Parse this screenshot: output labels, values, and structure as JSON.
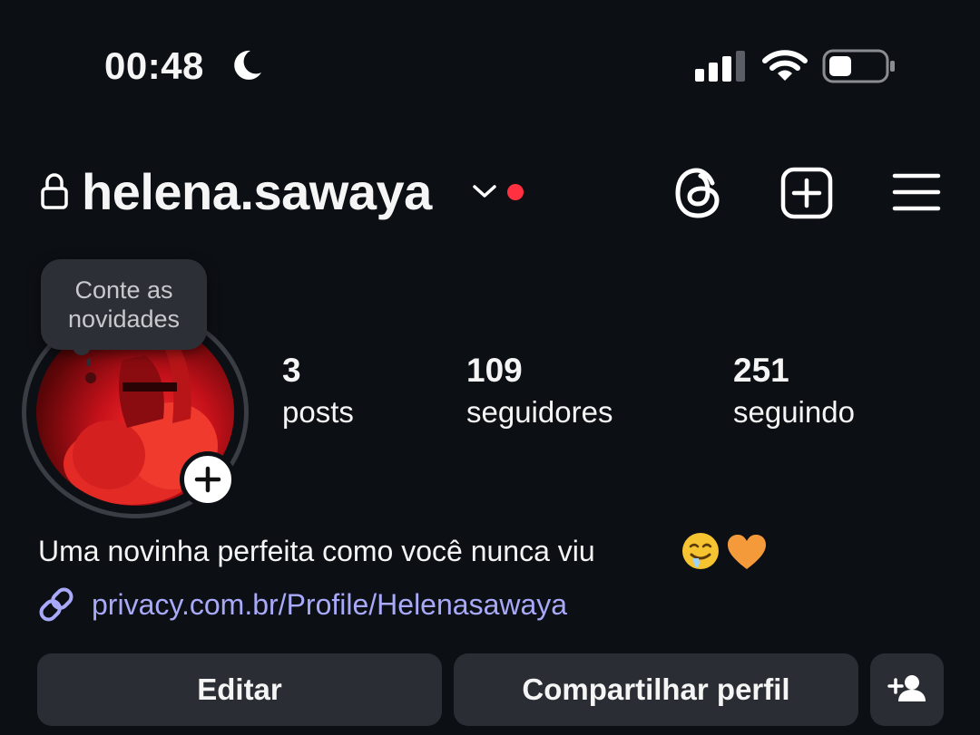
{
  "status_bar": {
    "time": "00:48",
    "icons": [
      "moon-icon",
      "signal-icon",
      "wifi-icon",
      "battery-icon"
    ]
  },
  "header": {
    "username": "helena.sawaya",
    "icons": [
      "lock-icon",
      "chevron-down-icon",
      "threads-icon",
      "new-post-icon",
      "menu-icon"
    ],
    "notification_dot_color": "#ff3040"
  },
  "profile": {
    "note_bubble": {
      "line1": "Conte as",
      "line2": "novidades"
    },
    "stats": [
      {
        "value": "3",
        "label": "posts"
      },
      {
        "value": "109",
        "label": "seguidores"
      },
      {
        "value": "251",
        "label": "seguindo"
      }
    ],
    "bio": "Uma novinha perfeita como você nunca viu",
    "bio_emojis": [
      "drooling-face",
      "orange-heart"
    ],
    "link": "privacy.com.br/Profile/Helenasawaya",
    "link_color": "#a8a9f8"
  },
  "actions": {
    "edit_label": "Editar",
    "share_label": "Compartilhar perfil",
    "add_icon": "add-person-icon"
  },
  "colors": {
    "background": "#0c0f14",
    "button_bg": "#2a2d33",
    "bubble_bg": "#2c2f36"
  }
}
